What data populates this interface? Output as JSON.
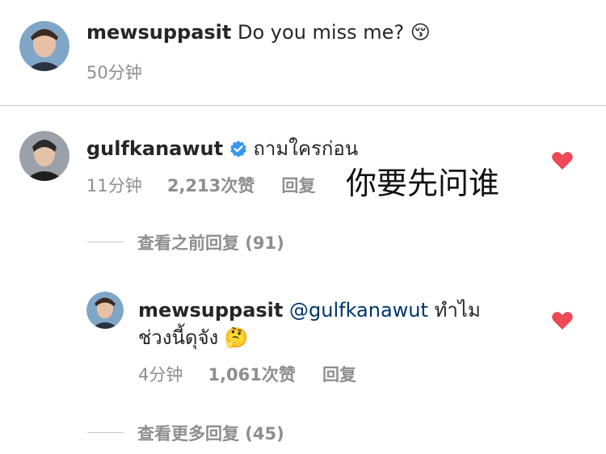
{
  "caption": {
    "username": "mewsuppasit",
    "text": "Do you miss me?",
    "emoji": "😚",
    "time": "50分钟"
  },
  "comment": {
    "username": "gulfkanawut",
    "verified_icon": "verified-badge-icon",
    "text": "ถามใครก่อน",
    "translation": "你要先问谁",
    "time": "11分钟",
    "likes": "2,213次赞",
    "reply_label": "回复",
    "heart_color": "#ed4956"
  },
  "previous_replies": "查看之前回复 (91)",
  "reply": {
    "username": "mewsuppasit",
    "mention": "@gulfkanawut",
    "text_line1": "ทำไม",
    "text_line2": "ช่วงนี้ดุจัง",
    "emoji": "🤔",
    "time": "4分钟",
    "likes": "1,061次赞",
    "reply_label": "回复"
  },
  "more_replies": "查看更多回复 (45)",
  "colors": {
    "accent_blue": "#3897f0",
    "mention": "#003569",
    "heart": "#ed4956",
    "meta": "#8e8e8e"
  }
}
